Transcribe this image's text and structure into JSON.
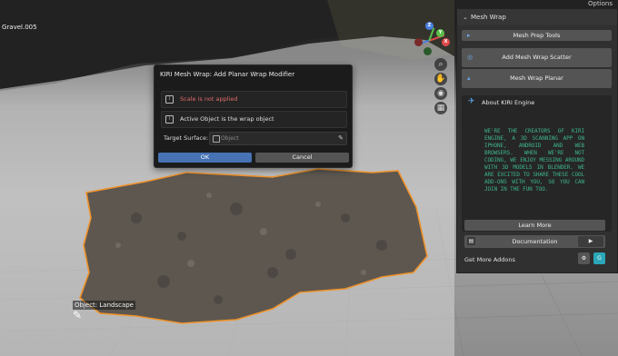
{
  "viewport": {
    "object_name": "Gravel.005",
    "tooltip": "Object: Landscape",
    "options_label": "Options"
  },
  "dialog": {
    "title": "KIRI Mesh Wrap: Add Planar Wrap Modifier",
    "warning": "Scale is not applied",
    "active_object_note": "Active Object is the wrap object",
    "target_surface_label": "Target Surface:",
    "target_placeholder": "Object",
    "ok_label": "OK",
    "cancel_label": "Cancel"
  },
  "panel": {
    "header": "Mesh Wrap",
    "prep_tools": "Mesh Prep Tools",
    "add_scatter": "Add Mesh Wrap Scatter",
    "wrap_planar": "Mesh Wrap Planar",
    "about_title": "About KIRI Engine",
    "about_text": "WE'RE THE CREATORS OF KIRI ENGINE, A 3D SCANNING APP ON IPHONE, ANDROID AND WEB BROWSERS. WHEN WE'RE NOT CODING, WE ENJOY MESSING AROUND WITH 3D MODELS IN BLENDER. WE ARE EXCITED TO SHARE THESE COOL ADD-ONS WITH YOU, SO YOU CAN JOIN IN THE FUN TOO.",
    "learn_more": "Learn More",
    "documentation": "Documentation",
    "more_addons": "Get More Addons"
  },
  "colors": {
    "accent_blue": "#4772b3",
    "warning_red": "#e36a6a",
    "about_green": "#3db48a",
    "selection_orange": "#f0932b"
  },
  "gizmo": {
    "x_label": "X",
    "y_label": "Y",
    "z_label": "Z"
  }
}
